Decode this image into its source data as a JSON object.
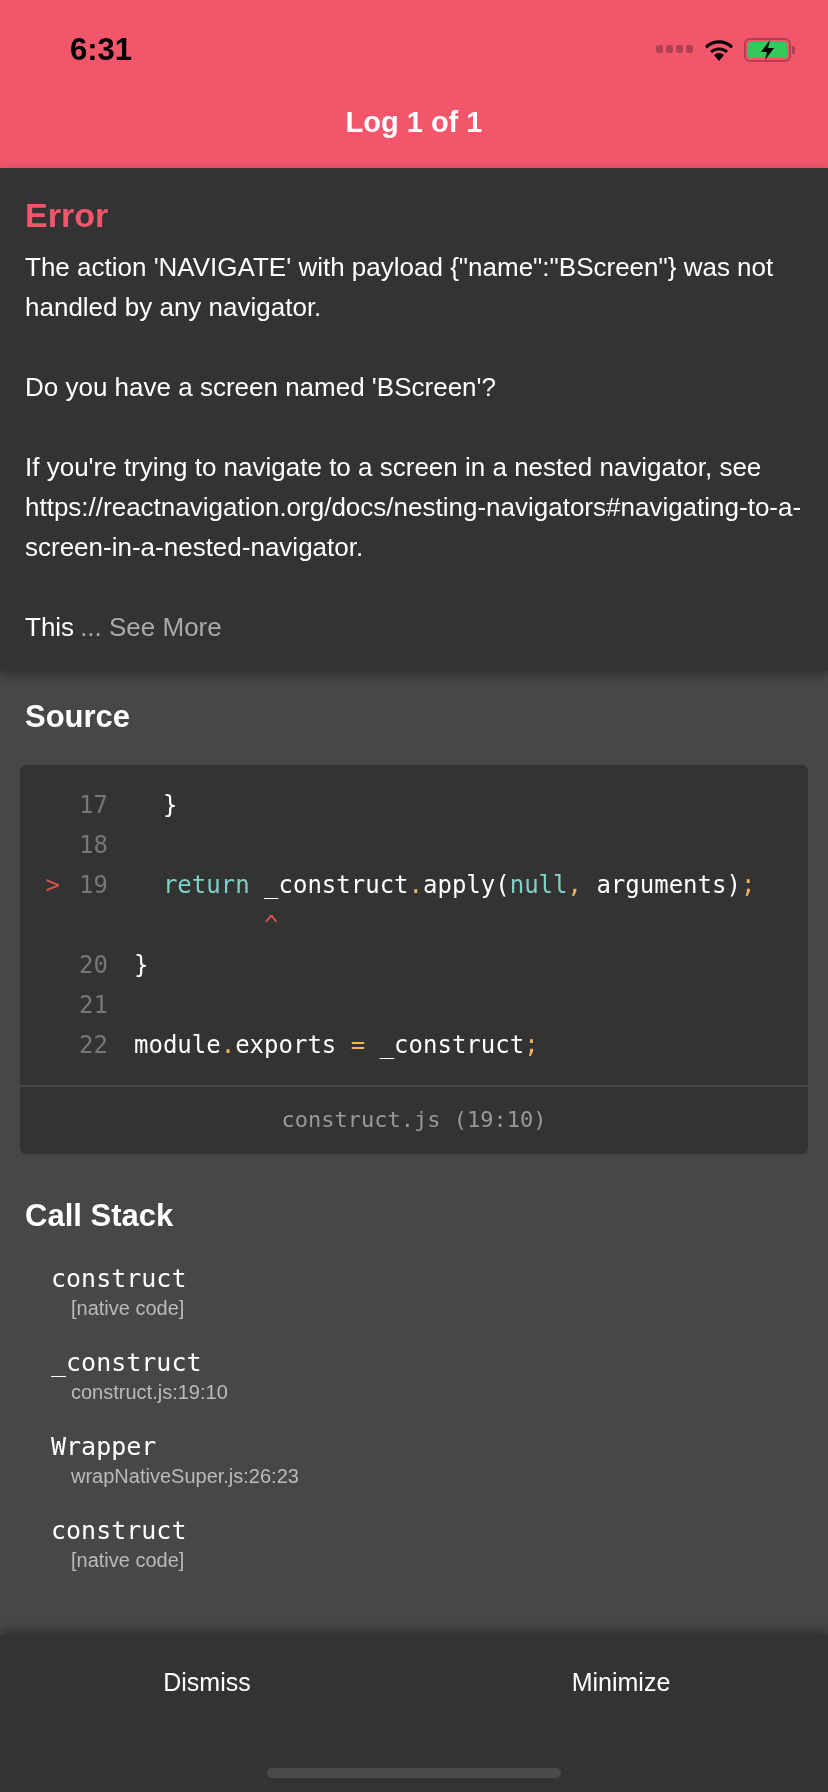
{
  "status_bar": {
    "time": "6:31"
  },
  "header": {
    "title": "Log 1 of 1"
  },
  "error": {
    "title": "Error",
    "paragraphs": [
      "The action 'NAVIGATE' with payload {\"name\":\"BScreen\"} was not handled by any navigator.",
      "Do you have a screen named 'BScreen'?",
      "If you're trying to navigate to a screen in a nested navigator, see https://reactnavigation.org/docs/nesting-navigators#navigating-to-a-screen-in-a-nested-navigator."
    ],
    "truncated_text": "This",
    "see_more": "... See More"
  },
  "source": {
    "title": "Source",
    "lines": [
      {
        "kind": "code",
        "number": "17",
        "tokens": [
          {
            "text": "  }",
            "kind": "plain"
          }
        ]
      },
      {
        "kind": "code",
        "number": "18"
      },
      {
        "kind": "code",
        "number": "19",
        "marker": ">",
        "tokens": [
          {
            "text": "  return",
            "kind": "keyword"
          },
          {
            "text": " _construct",
            "kind": "plain"
          },
          {
            "text": ".",
            "kind": "punct"
          },
          {
            "text": "apply(",
            "kind": "plain"
          },
          {
            "text": "null",
            "kind": "keyword"
          },
          {
            "text": ",",
            "kind": "punct"
          },
          {
            "text": " arguments)",
            "kind": "plain"
          },
          {
            "text": ";",
            "kind": "punct"
          }
        ]
      },
      {
        "kind": "caret",
        "text": "         ^"
      },
      {
        "kind": "code",
        "number": "20",
        "tokens": [
          {
            "text": "}",
            "kind": "plain"
          }
        ]
      },
      {
        "kind": "code",
        "number": "21"
      },
      {
        "kind": "code",
        "number": "22",
        "tokens": [
          {
            "text": "module",
            "kind": "plain"
          },
          {
            "text": ".",
            "kind": "punct"
          },
          {
            "text": "exports ",
            "kind": "plain"
          },
          {
            "text": "=",
            "kind": "punct"
          },
          {
            "text": " _construct",
            "kind": "plain"
          },
          {
            "text": ";",
            "kind": "punct"
          }
        ]
      }
    ],
    "file": "construct.js (19:10)"
  },
  "call_stack": {
    "title": "Call Stack",
    "frames": [
      {
        "name": "construct",
        "location": "[native code]"
      },
      {
        "name": "_construct",
        "location": "construct.js:19:10"
      },
      {
        "name": "Wrapper",
        "location": "wrapNativeSuper.js:26:23"
      },
      {
        "name": "construct",
        "location": "[native code]"
      }
    ]
  },
  "buttons": [
    "Dismiss",
    "Minimize"
  ]
}
